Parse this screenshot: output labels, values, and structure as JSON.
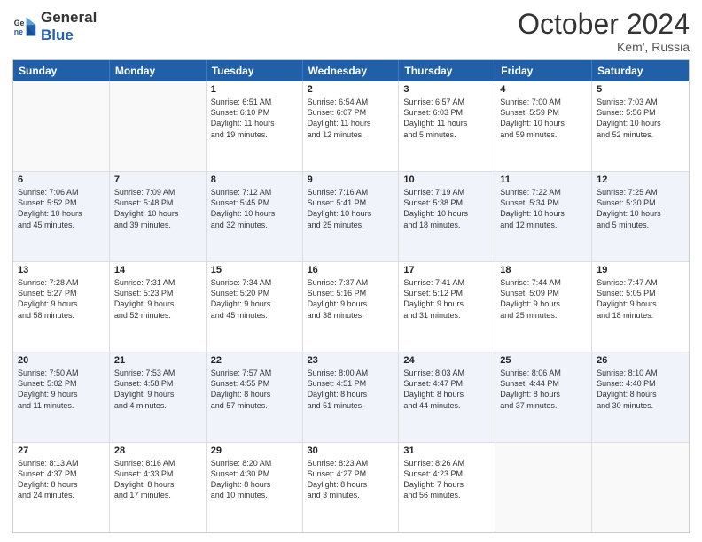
{
  "header": {
    "logo_line1": "General",
    "logo_line2": "Blue",
    "month": "October 2024",
    "location": "Kem', Russia"
  },
  "days": [
    "Sunday",
    "Monday",
    "Tuesday",
    "Wednesday",
    "Thursday",
    "Friday",
    "Saturday"
  ],
  "rows": [
    [
      {
        "day": "",
        "text": ""
      },
      {
        "day": "",
        "text": ""
      },
      {
        "day": "1",
        "text": "Sunrise: 6:51 AM\nSunset: 6:10 PM\nDaylight: 11 hours\nand 19 minutes."
      },
      {
        "day": "2",
        "text": "Sunrise: 6:54 AM\nSunset: 6:07 PM\nDaylight: 11 hours\nand 12 minutes."
      },
      {
        "day": "3",
        "text": "Sunrise: 6:57 AM\nSunset: 6:03 PM\nDaylight: 11 hours\nand 5 minutes."
      },
      {
        "day": "4",
        "text": "Sunrise: 7:00 AM\nSunset: 5:59 PM\nDaylight: 10 hours\nand 59 minutes."
      },
      {
        "day": "5",
        "text": "Sunrise: 7:03 AM\nSunset: 5:56 PM\nDaylight: 10 hours\nand 52 minutes."
      }
    ],
    [
      {
        "day": "6",
        "text": "Sunrise: 7:06 AM\nSunset: 5:52 PM\nDaylight: 10 hours\nand 45 minutes."
      },
      {
        "day": "7",
        "text": "Sunrise: 7:09 AM\nSunset: 5:48 PM\nDaylight: 10 hours\nand 39 minutes."
      },
      {
        "day": "8",
        "text": "Sunrise: 7:12 AM\nSunset: 5:45 PM\nDaylight: 10 hours\nand 32 minutes."
      },
      {
        "day": "9",
        "text": "Sunrise: 7:16 AM\nSunset: 5:41 PM\nDaylight: 10 hours\nand 25 minutes."
      },
      {
        "day": "10",
        "text": "Sunrise: 7:19 AM\nSunset: 5:38 PM\nDaylight: 10 hours\nand 18 minutes."
      },
      {
        "day": "11",
        "text": "Sunrise: 7:22 AM\nSunset: 5:34 PM\nDaylight: 10 hours\nand 12 minutes."
      },
      {
        "day": "12",
        "text": "Sunrise: 7:25 AM\nSunset: 5:30 PM\nDaylight: 10 hours\nand 5 minutes."
      }
    ],
    [
      {
        "day": "13",
        "text": "Sunrise: 7:28 AM\nSunset: 5:27 PM\nDaylight: 9 hours\nand 58 minutes."
      },
      {
        "day": "14",
        "text": "Sunrise: 7:31 AM\nSunset: 5:23 PM\nDaylight: 9 hours\nand 52 minutes."
      },
      {
        "day": "15",
        "text": "Sunrise: 7:34 AM\nSunset: 5:20 PM\nDaylight: 9 hours\nand 45 minutes."
      },
      {
        "day": "16",
        "text": "Sunrise: 7:37 AM\nSunset: 5:16 PM\nDaylight: 9 hours\nand 38 minutes."
      },
      {
        "day": "17",
        "text": "Sunrise: 7:41 AM\nSunset: 5:12 PM\nDaylight: 9 hours\nand 31 minutes."
      },
      {
        "day": "18",
        "text": "Sunrise: 7:44 AM\nSunset: 5:09 PM\nDaylight: 9 hours\nand 25 minutes."
      },
      {
        "day": "19",
        "text": "Sunrise: 7:47 AM\nSunset: 5:05 PM\nDaylight: 9 hours\nand 18 minutes."
      }
    ],
    [
      {
        "day": "20",
        "text": "Sunrise: 7:50 AM\nSunset: 5:02 PM\nDaylight: 9 hours\nand 11 minutes."
      },
      {
        "day": "21",
        "text": "Sunrise: 7:53 AM\nSunset: 4:58 PM\nDaylight: 9 hours\nand 4 minutes."
      },
      {
        "day": "22",
        "text": "Sunrise: 7:57 AM\nSunset: 4:55 PM\nDaylight: 8 hours\nand 57 minutes."
      },
      {
        "day": "23",
        "text": "Sunrise: 8:00 AM\nSunset: 4:51 PM\nDaylight: 8 hours\nand 51 minutes."
      },
      {
        "day": "24",
        "text": "Sunrise: 8:03 AM\nSunset: 4:47 PM\nDaylight: 8 hours\nand 44 minutes."
      },
      {
        "day": "25",
        "text": "Sunrise: 8:06 AM\nSunset: 4:44 PM\nDaylight: 8 hours\nand 37 minutes."
      },
      {
        "day": "26",
        "text": "Sunrise: 8:10 AM\nSunset: 4:40 PM\nDaylight: 8 hours\nand 30 minutes."
      }
    ],
    [
      {
        "day": "27",
        "text": "Sunrise: 8:13 AM\nSunset: 4:37 PM\nDaylight: 8 hours\nand 24 minutes."
      },
      {
        "day": "28",
        "text": "Sunrise: 8:16 AM\nSunset: 4:33 PM\nDaylight: 8 hours\nand 17 minutes."
      },
      {
        "day": "29",
        "text": "Sunrise: 8:20 AM\nSunset: 4:30 PM\nDaylight: 8 hours\nand 10 minutes."
      },
      {
        "day": "30",
        "text": "Sunrise: 8:23 AM\nSunset: 4:27 PM\nDaylight: 8 hours\nand 3 minutes."
      },
      {
        "day": "31",
        "text": "Sunrise: 8:26 AM\nSunset: 4:23 PM\nDaylight: 7 hours\nand 56 minutes."
      },
      {
        "day": "",
        "text": ""
      },
      {
        "day": "",
        "text": ""
      }
    ]
  ]
}
